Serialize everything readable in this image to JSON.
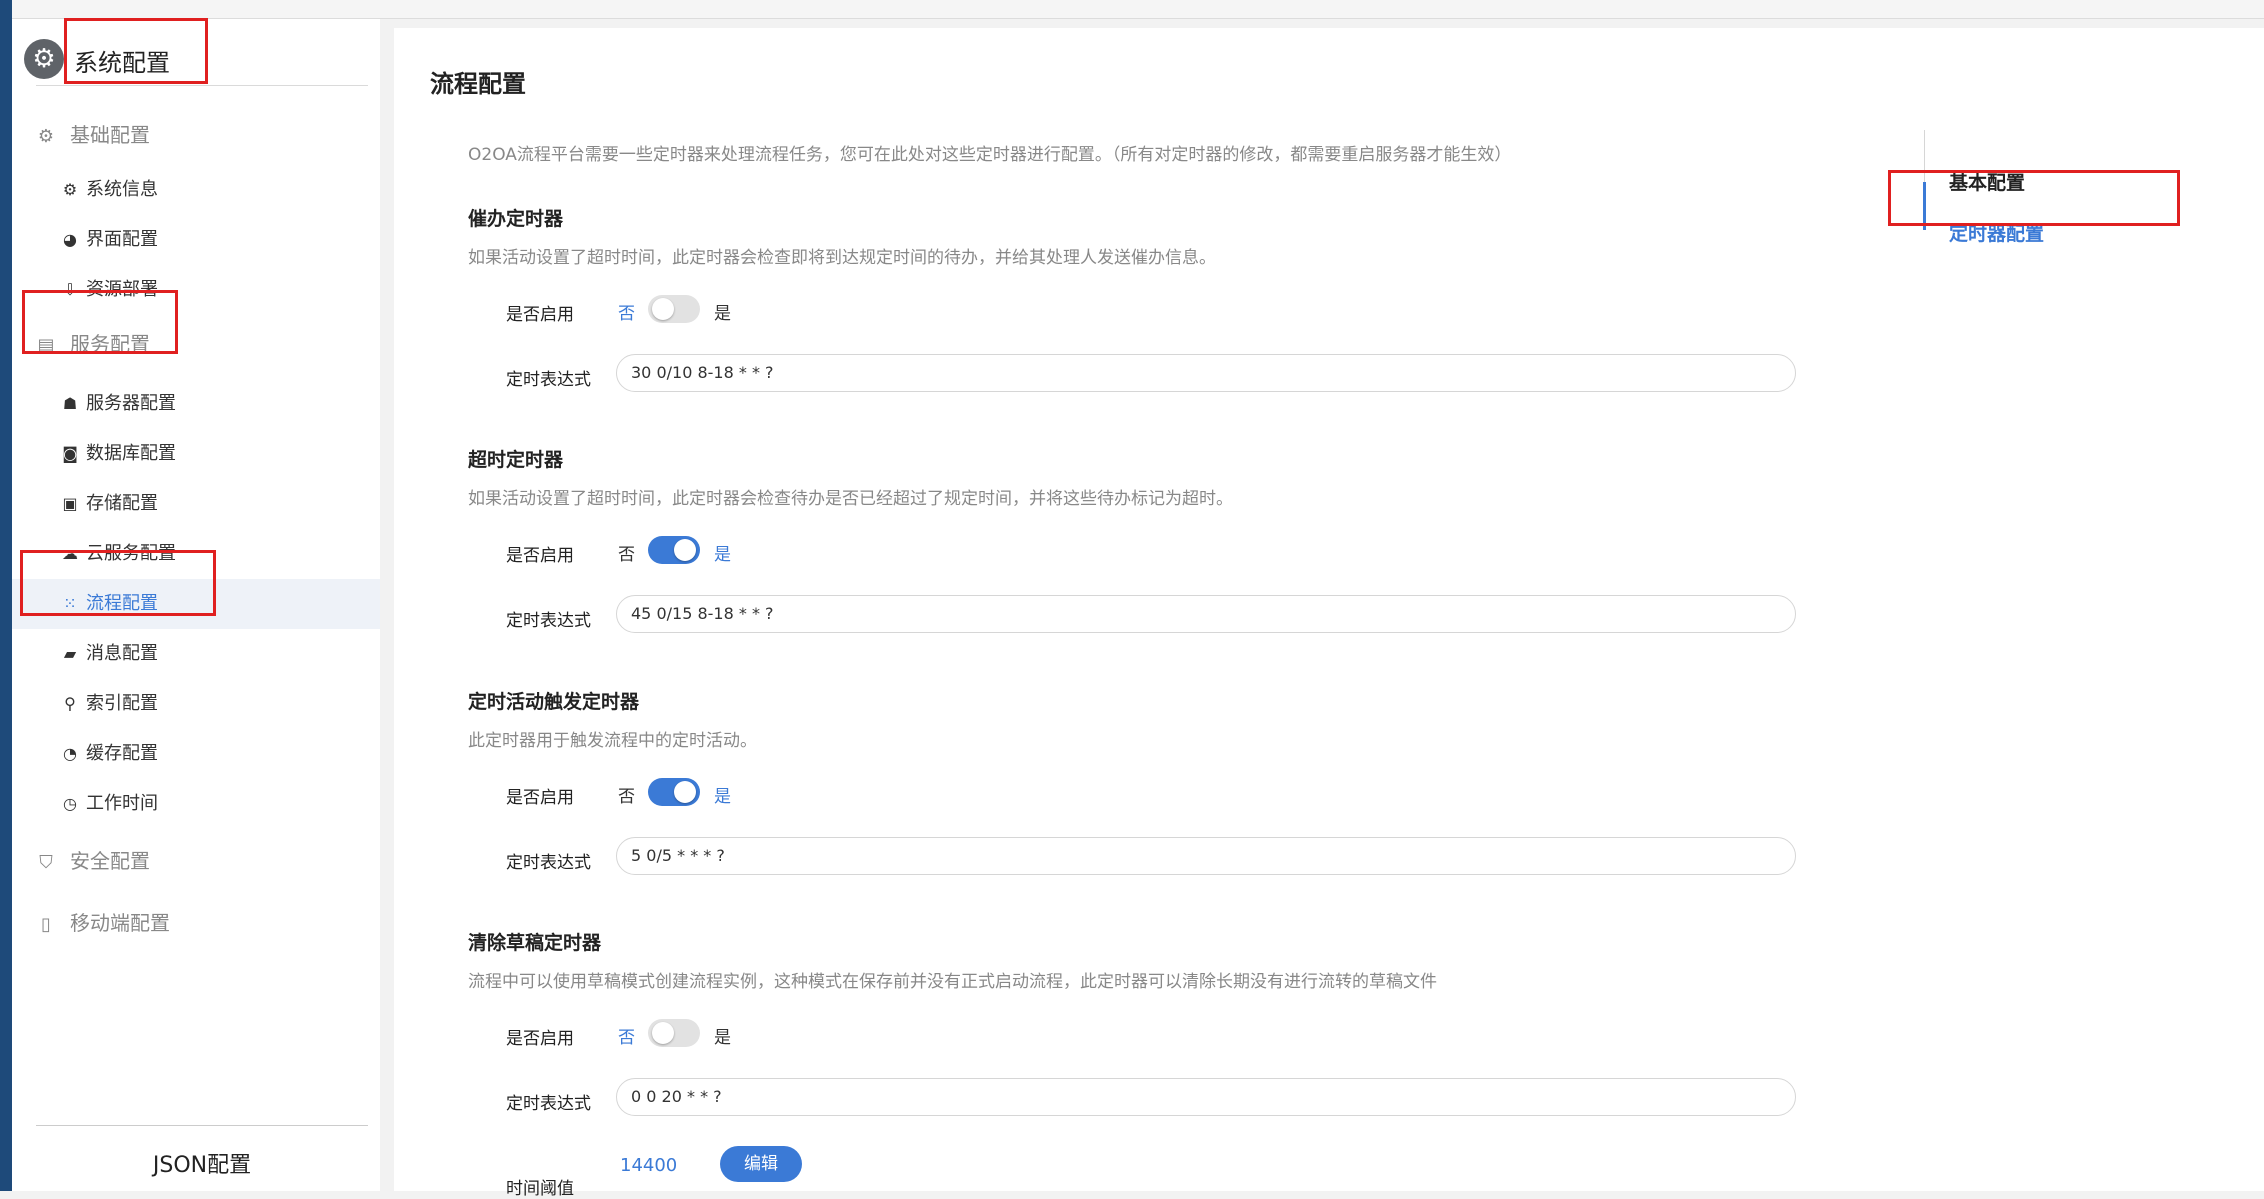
{
  "sidebar": {
    "header": {
      "title": "系统配置",
      "icon": "gear-icon"
    },
    "groups": [
      {
        "label": "基础配置",
        "icon": "gear-icon"
      },
      {
        "label": "服务配置",
        "icon": "server-icon"
      },
      {
        "label": "安全配置",
        "icon": "shield-icon"
      },
      {
        "label": "移动端配置",
        "icon": "mobile-icon"
      }
    ],
    "basic_items": [
      {
        "label": "系统信息",
        "icon": "gear-icon"
      },
      {
        "label": "界面配置",
        "icon": "palette-icon"
      },
      {
        "label": "资源部署",
        "icon": "deploy-icon"
      }
    ],
    "service_items": [
      {
        "label": "服务器配置",
        "icon": "server-user-icon"
      },
      {
        "label": "数据库配置",
        "icon": "database-icon"
      },
      {
        "label": "存储配置",
        "icon": "storage-icon"
      },
      {
        "label": "云服务配置",
        "icon": "cloud-icon"
      },
      {
        "label": "流程配置",
        "icon": "process-icon",
        "active": true
      },
      {
        "label": "消息配置",
        "icon": "message-icon"
      },
      {
        "label": "索引配置",
        "icon": "search-icon"
      },
      {
        "label": "缓存配置",
        "icon": "pie-icon"
      },
      {
        "label": "工作时间",
        "icon": "timer-icon"
      }
    ],
    "footer": "JSON配置"
  },
  "main": {
    "title": "流程配置",
    "description": "O2OA流程平台需要一些定时器来处理流程任务，您可在此处对这些定时器进行配置。（所有对定时器的修改，都需要重启服务器才能生效）",
    "enable_label": "是否启用",
    "off_label": "否",
    "on_label": "是",
    "expression_label": "定时表达式",
    "sections": [
      {
        "title": "催办定时器",
        "desc": "如果活动设置了超时时间，此定时器会检查即将到达规定时间的待办，并给其处理人发送催办信息。",
        "enabled": false,
        "expression": "30 0/10 8-18 * * ?"
      },
      {
        "title": "超时定时器",
        "desc": "如果活动设置了超时时间，此定时器会检查待办是否已经超过了规定时间，并将这些待办标记为超时。",
        "enabled": true,
        "expression": "45 0/15 8-18 * * ?"
      },
      {
        "title": "定时活动触发定时器",
        "desc": "此定时器用于触发流程中的定时活动。",
        "enabled": true,
        "expression": "5 0/5 * * * ?"
      },
      {
        "title": "清除草稿定时器",
        "desc": "流程中可以使用草稿模式创建流程实例，这种模式在保存前并没有正式启动流程，此定时器可以清除长期没有进行流转的草稿文件",
        "enabled": false,
        "expression": "0 0 20 * * ?"
      }
    ],
    "threshold": {
      "label": "时间阈值",
      "value": "14400",
      "edit_label": "编辑"
    }
  },
  "right_nav": {
    "items": [
      {
        "label": "基本配置",
        "active": false
      },
      {
        "label": "定时器配置",
        "active": true
      }
    ]
  },
  "colors": {
    "accent": "#3b7ad6",
    "highlight": "#e02020"
  }
}
